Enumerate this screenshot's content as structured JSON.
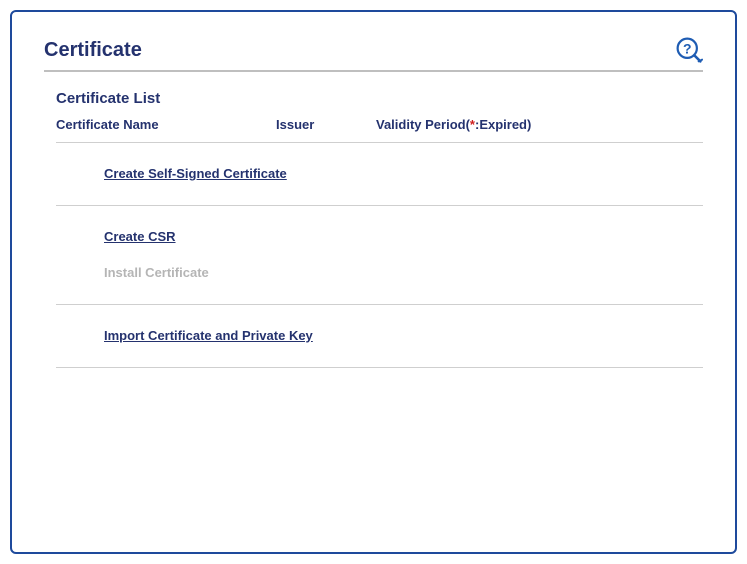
{
  "header": {
    "title": "Certificate"
  },
  "list": {
    "subtitle": "Certificate List",
    "columns": {
      "name": "Certificate Name",
      "issuer": "Issuer",
      "validity_prefix": "Validity Period(",
      "validity_mark": "*",
      "validity_suffix": ":Expired)"
    }
  },
  "actions": {
    "create_self_signed": "Create Self-Signed Certificate",
    "create_csr": "Create CSR",
    "install_cert": "Install Certificate",
    "import_cert_key": "Import Certificate and Private Key"
  }
}
